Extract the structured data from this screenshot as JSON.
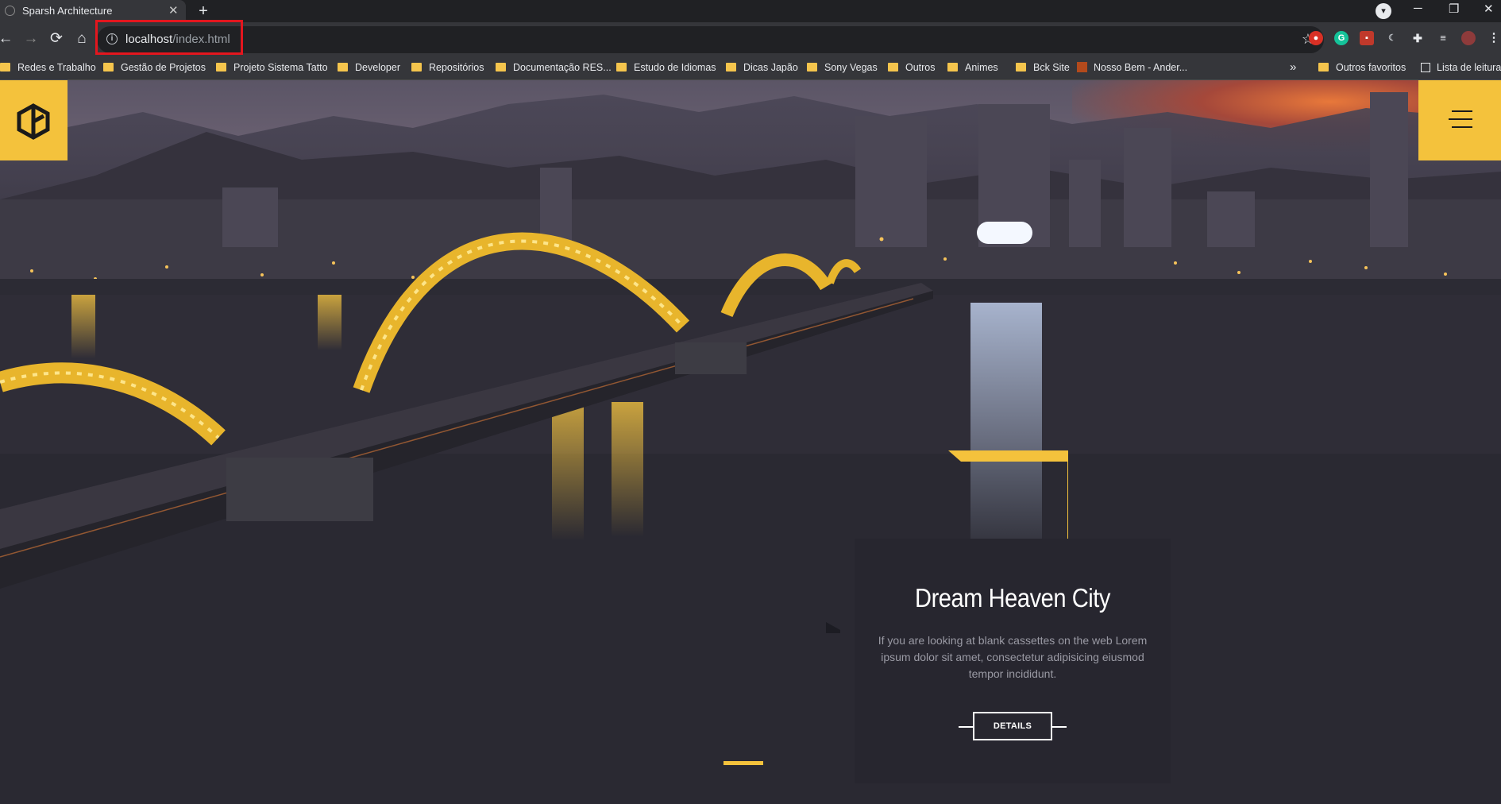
{
  "browser": {
    "tab_title": "Sparsh Architecture",
    "tab_close": "✕",
    "new_tab": "+",
    "window_controls": [
      "─",
      "❐",
      "✕"
    ],
    "url_host": "localhost",
    "url_path": "/index.html",
    "bookmarks": [
      "Redes e Trabalho",
      "Gestão de Projetos",
      "Projeto Sistema Tatto",
      "Developer",
      "Repositórios",
      "Documentação RES...",
      "Estudo de Idiomas",
      "Dicas Japão",
      "Sony Vegas",
      "Outros",
      "Animes",
      "Bck Site",
      "Nosso Bem - Ander..."
    ],
    "overflow": "»",
    "other_bookmarks": "Outros favoritos",
    "reading_list": "Lista de leitura",
    "accent_highlight": "#e3161e"
  },
  "page": {
    "card": {
      "title": "Dream Heaven City",
      "text": "If you are looking at blank cassettes on the web Lorem ipsum dolor sit amet, consectetur adipisicing eiusmod tempor incididunt.",
      "button": "DETAILS"
    },
    "accent_color": "#f4c23c",
    "card_color": "#27262f",
    "slider_active_index": 1
  }
}
